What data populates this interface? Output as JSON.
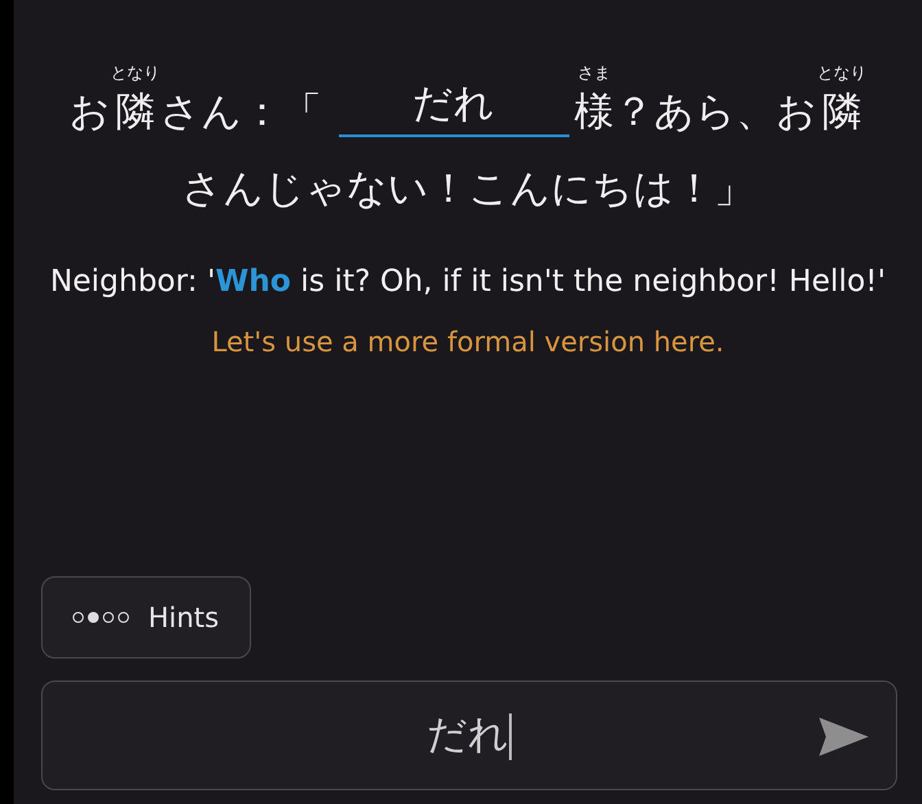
{
  "sentence": {
    "lines": [
      [
        {
          "kind": "text",
          "text": "お"
        },
        {
          "kind": "ruby",
          "text": "隣",
          "ruby": "となり"
        },
        {
          "kind": "text",
          "text": "さん：「"
        },
        {
          "kind": "blank",
          "text": "だれ"
        },
        {
          "kind": "ruby",
          "text": "様",
          "ruby": "さま"
        },
        {
          "kind": "text",
          "text": "？あら、お"
        },
        {
          "kind": "ruby",
          "text": "隣",
          "ruby": "となり"
        }
      ],
      [
        {
          "kind": "text",
          "text": "さんじゃない！こんにちは！」"
        }
      ]
    ]
  },
  "translation": "Neighbor: '**Who** is it? Oh, if it isn't the neighbor! Hello!'",
  "feedback": "Let's use a more formal version here.",
  "hints": {
    "label": "Hints",
    "dots": [
      {
        "filled": false
      },
      {
        "filled": true
      },
      {
        "filled": false
      },
      {
        "filled": false
      }
    ]
  },
  "answer": {
    "value": "だれ"
  }
}
